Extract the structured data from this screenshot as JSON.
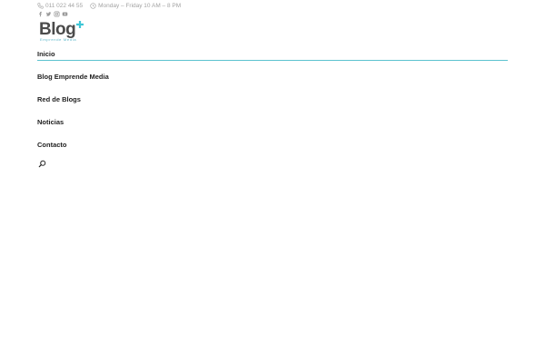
{
  "topbar": {
    "phone": "011 022 44 55",
    "hours": "Monday – Friday 10 AM – 8 PM"
  },
  "social": [
    "facebook-icon",
    "twitter-icon",
    "instagram-icon",
    "youtube-icon"
  ],
  "logo": {
    "word": "Blog",
    "subtitle": "Emprende Media"
  },
  "nav": {
    "items": [
      {
        "label": "Inicio"
      },
      {
        "label": "Blog Emprende Media"
      },
      {
        "label": "Red de Blogs"
      },
      {
        "label": "Noticias"
      },
      {
        "label": "Contacto"
      }
    ]
  },
  "colors": {
    "accent": "#5cc3cf",
    "text": "#222222",
    "muted": "#a3a3a3"
  }
}
